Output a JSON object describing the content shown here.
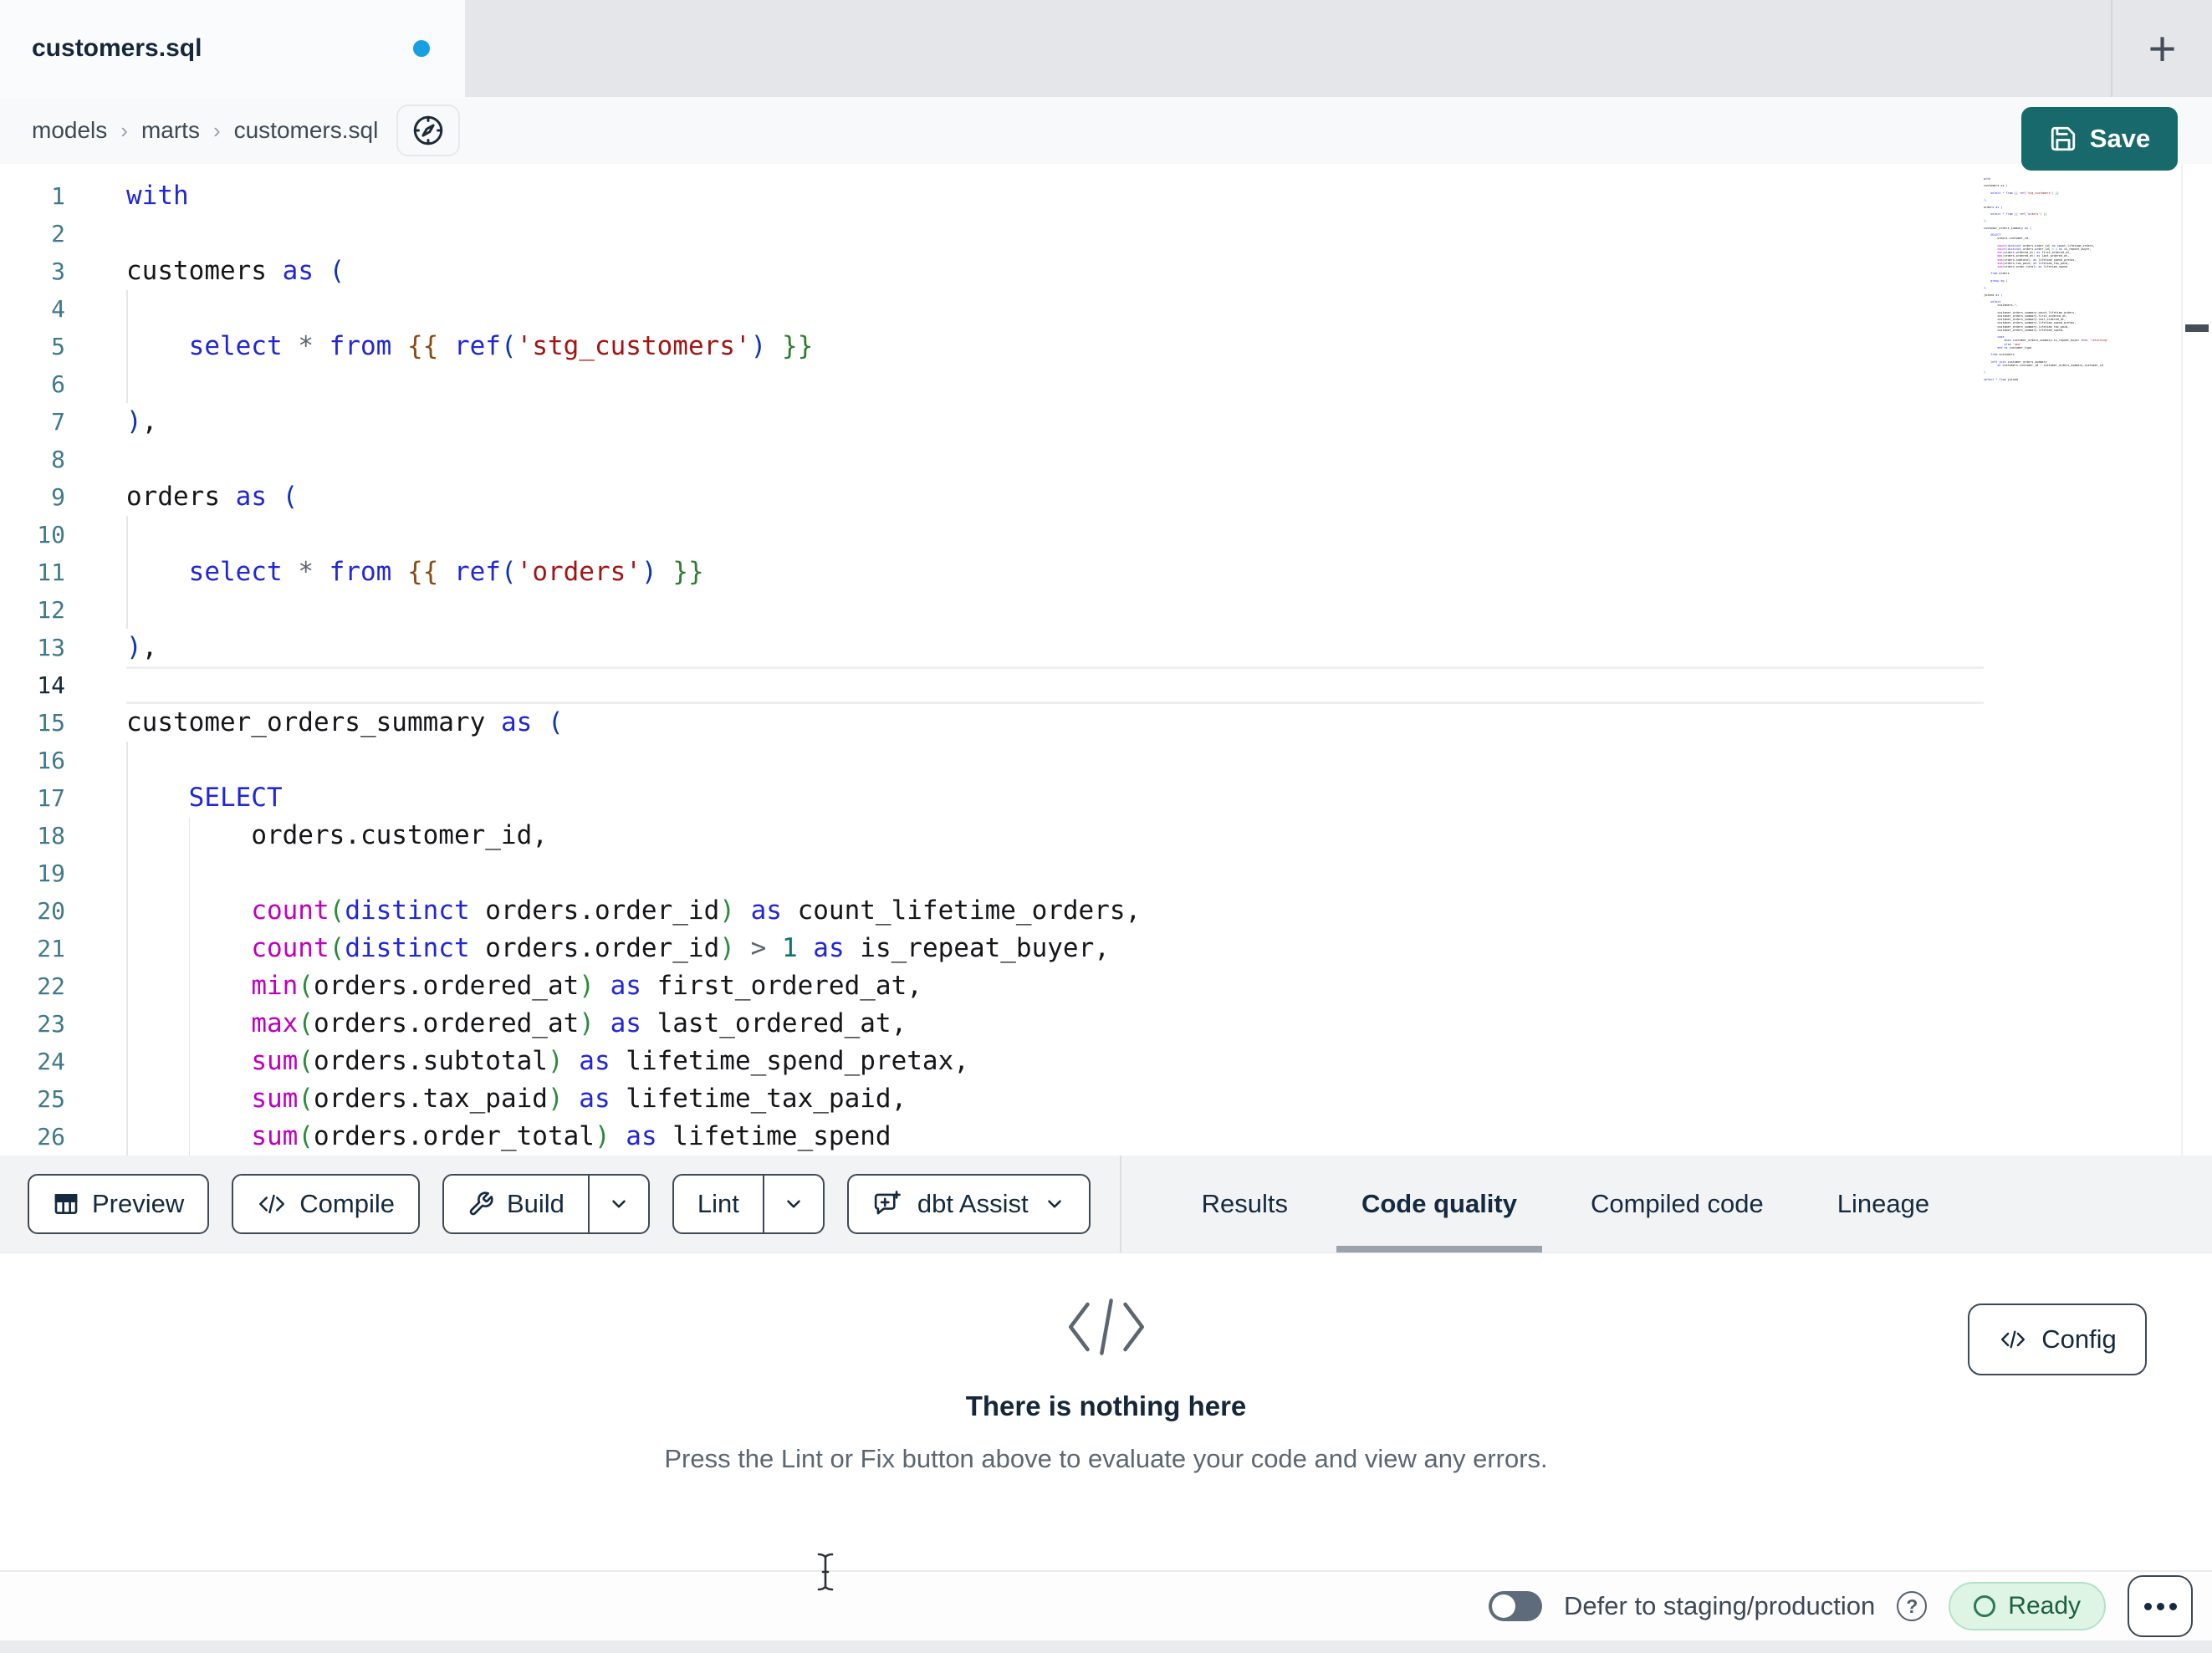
{
  "window": {
    "tab_title": "customers.sql",
    "new_tab_label": "+",
    "unsaved_indicator_color": "#169fe2"
  },
  "breadcrumb": {
    "items": [
      "models",
      "marts",
      "customers.sql"
    ],
    "separator": "›"
  },
  "save_button": {
    "label": "Save",
    "color": "#17696c"
  },
  "editor": {
    "active_line": 14,
    "lines": [
      "with",
      "",
      "customers as (",
      "    ",
      "    select * from {{ ref('stg_customers') }}",
      "    ",
      "),",
      "",
      "orders as (",
      "    ",
      "    select * from {{ ref('orders') }}",
      "    ",
      "),",
      "",
      "customer_orders_summary as (",
      "    ",
      "    SELECT",
      "        orders.customer_id,",
      "        ",
      "        count(distinct orders.order_id) as count_lifetime_orders,",
      "        count(distinct orders.order_id) > 1 as is_repeat_buyer,",
      "        min(orders.ordered_at) as first_ordered_at,",
      "        max(orders.ordered_at) as last_ordered_at,",
      "        sum(orders.subtotal) as lifetime_spend_pretax,",
      "        sum(orders.tax_paid) as lifetime_tax_paid,",
      "        sum(orders.order_total) as lifetime_spend"
    ],
    "minimap_lines": [
      "with",
      "",
      "customers as (",
      "",
      "    select * from {{ ref('stg_customers') }}",
      "",
      "),",
      "",
      "orders as (",
      "",
      "    select * from {{ ref('orders') }}",
      "",
      "),",
      "",
      "customer_orders_summary as (",
      "",
      "    SELECT",
      "        orders.customer_id,",
      "",
      "        count(distinct orders.order_id) as count_lifetime_orders,",
      "        count(distinct orders.order_id) > 1 as is_repeat_buyer,",
      "        min(orders.ordered_at) as first_ordered_at,",
      "        max(orders.ordered_at) as last_ordered_at,",
      "        sum(orders.subtotal) as lifetime_spend_pretax,",
      "        sum(orders.tax_paid) as lifetime_tax_paid,",
      "        sum(orders.order_total) as lifetime_spend",
      "",
      "    from orders",
      "",
      "    group by 1",
      "",
      "),",
      "",
      "joined as (",
      "",
      "    select",
      "        customers.*,",
      "",
      "        customer_orders_summary.count_lifetime_orders,",
      "        customer_orders_summary.first_ordered_at,",
      "        customer_orders_summary.last_ordered_at,",
      "        customer_orders_summary.lifetime_spend_pretax,",
      "        customer_orders_summary.lifetime_tax_paid,",
      "        customer_orders_summary.lifetime_spend,",
      "",
      "        case",
      "            when customer_orders_summary.is_repeat_buyer then 'returning'",
      "            else 'new'",
      "        end as customer_type",
      "",
      "    from customers",
      "",
      "    left join customer_orders_summary",
      "        on customers.customer_id = customer_orders_summary.customer_id",
      "",
      ")",
      "",
      "select * from joined"
    ]
  },
  "toolbar": {
    "preview": "Preview",
    "compile": "Compile",
    "build": "Build",
    "lint": "Lint",
    "assist": "dbt Assist"
  },
  "panel_tabs": {
    "results": "Results",
    "code_quality": "Code quality",
    "compiled": "Compiled code",
    "lineage": "Lineage"
  },
  "results_panel": {
    "title": "There is nothing here",
    "subtitle": "Press the Lint or Fix button above to evaluate your code and view any errors.",
    "config_label": "Config"
  },
  "statusbar": {
    "defer_label": "Defer to staging/production",
    "status_label": "Ready",
    "status_color": "#def4e5"
  }
}
